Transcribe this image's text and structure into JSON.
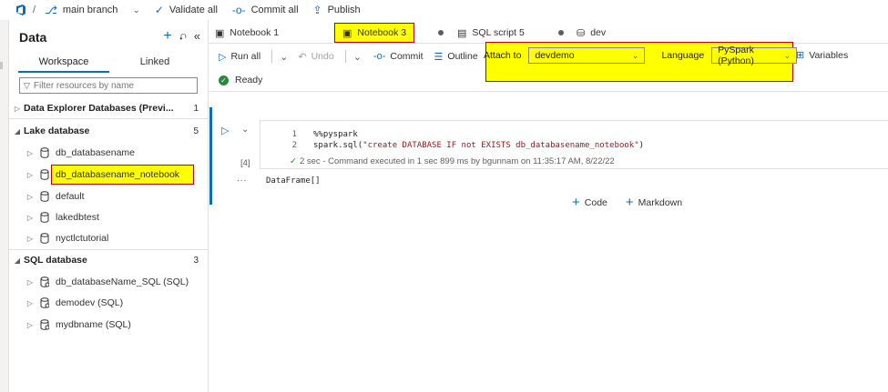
{
  "topbar": {
    "separator": "/",
    "branch": "main branch",
    "validate_all": "Validate all",
    "commit_all": "Commit all",
    "publish": "Publish"
  },
  "data_pane": {
    "title": "Data",
    "tabs": [
      "Workspace",
      "Linked"
    ],
    "active_tab": "Workspace",
    "filter_placeholder": "Filter resources by name",
    "sections": [
      {
        "label": "Data Explorer Databases (Previ...",
        "count": "1",
        "expanded": false
      },
      {
        "label": "Lake database",
        "count": "5",
        "expanded": true
      },
      {
        "label": "SQL database",
        "count": "3",
        "expanded": true
      }
    ],
    "lake_items": [
      "db_databasename",
      "db_databasename_notebook",
      "default",
      "lakedbtest",
      "nyctlctutorial"
    ],
    "sql_items": [
      "db_databaseName_SQL (SQL)",
      "demodev (SQL)",
      "mydbname (SQL)"
    ]
  },
  "tabs": [
    {
      "label": "Notebook 1",
      "icon": "notebook-icon"
    },
    {
      "label": "Notebook 3",
      "icon": "notebook-icon",
      "active": true,
      "highlighted": true
    },
    {
      "label": "SQL script 5",
      "icon": "sql-script-icon"
    },
    {
      "label": "dev",
      "icon": "database-icon"
    }
  ],
  "toolbar": {
    "run_all": "Run all",
    "undo": "Undo",
    "commit": "Commit",
    "outline": "Outline",
    "attach_to_label": "Attach to",
    "attach_to_value": "devdemo",
    "language_label": "Language",
    "language_value": "PySpark (Python)",
    "variables": "Variables"
  },
  "status": {
    "text": "Ready",
    "color": "#2e8540"
  },
  "cell": {
    "lines": [
      {
        "num": "1",
        "code": "%%pyspark"
      },
      {
        "num": "2",
        "code_prefix": "spark.sql(",
        "code_string": "\"create DATABASE IF not EXISTS db_databasename_notebook\"",
        "code_suffix": ")"
      }
    ],
    "exec_count": "[4]",
    "exec_info": "2 sec - Command executed in 1 sec 899 ms by bgunnam on 11:35:17 AM, 8/22/22",
    "output_more": "...",
    "output": "DataFrame[]"
  },
  "add_cell": {
    "code": "Code",
    "markdown": "Markdown"
  },
  "colors": {
    "accent": "#0f6cbd",
    "highlight": "#ffff00",
    "highlight_border": "#c00000"
  }
}
